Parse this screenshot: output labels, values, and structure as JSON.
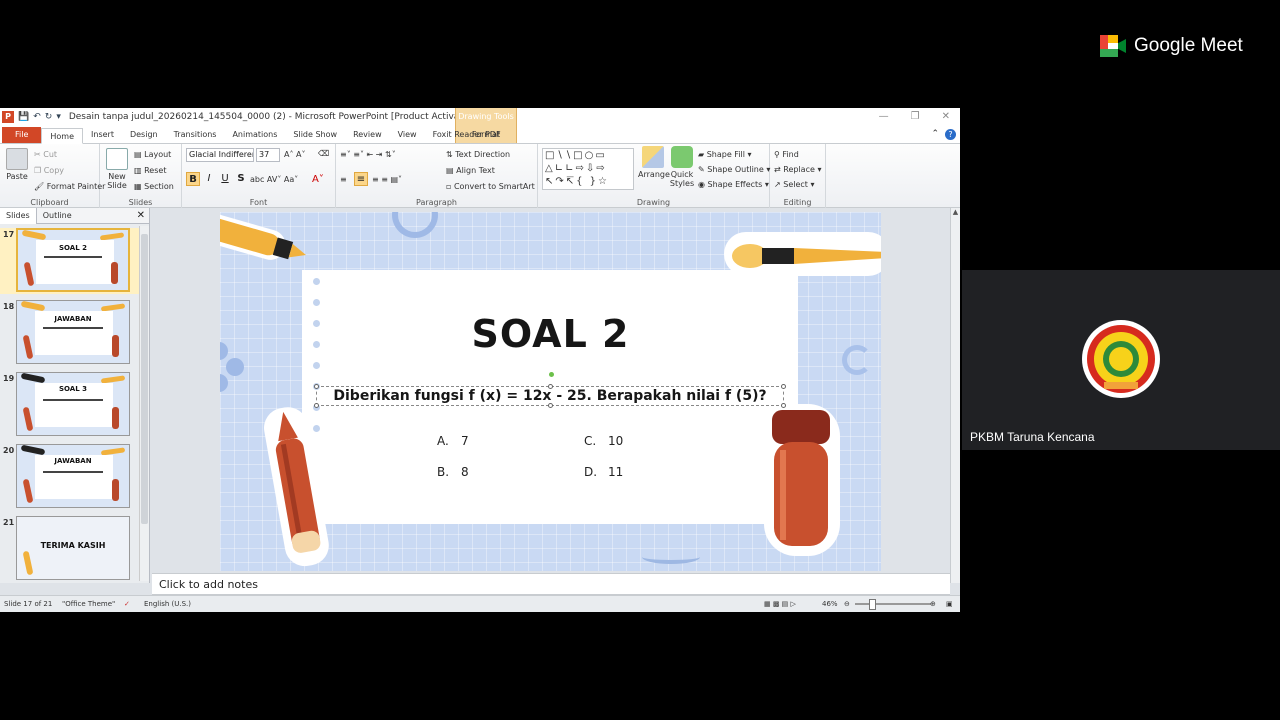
{
  "window": {
    "title": "Desain tanpa judul_20260214_145504_0000 (2)  -  Microsoft PowerPoint [Product Activatio...",
    "context_tab_title": "Drawing Tools"
  },
  "ribbon_tabs": [
    "File",
    "Home",
    "Insert",
    "Design",
    "Transitions",
    "Animations",
    "Slide Show",
    "Review",
    "View",
    "Foxit Reader PDF"
  ],
  "format_tab": "Format",
  "clipboard": {
    "paste": "Paste",
    "cut": "Cut",
    "copy": "Copy",
    "format_painter": "Format Painter",
    "label": "Clipboard"
  },
  "slides_group": {
    "new_slide": "New Slide",
    "layout": "Layout",
    "reset": "Reset",
    "section": "Section",
    "label": "Slides"
  },
  "font_group": {
    "font_name": "Glacial Indifferenc",
    "font_size": "37",
    "label": "Font",
    "bold": "B",
    "italic": "I",
    "underline": "U",
    "strike": "S"
  },
  "paragraph_group": {
    "text_direction": "Text Direction",
    "align_text": "Align Text",
    "smartart": "Convert to SmartArt",
    "label": "Paragraph"
  },
  "drawing_group": {
    "arrange": "Arrange",
    "quick_styles": "Quick Styles",
    "shape_fill": "Shape Fill",
    "shape_outline": "Shape Outline",
    "shape_effects": "Shape Effects",
    "label": "Drawing"
  },
  "editing_group": {
    "find": "Find",
    "replace": "Replace",
    "select": "Select",
    "label": "Editing"
  },
  "panel": {
    "tab_slides": "Slides",
    "tab_outline": "Outline"
  },
  "thumbnails": [
    {
      "num": "17",
      "title": "SOAL 2"
    },
    {
      "num": "18",
      "title": "JAWABAN"
    },
    {
      "num": "19",
      "title": "SOAL 3"
    },
    {
      "num": "20",
      "title": "JAWABAN"
    },
    {
      "num": "21",
      "title": "TERIMA KASIH"
    }
  ],
  "slide": {
    "title": "SOAL 2",
    "question": "Diberikan fungsi f (x) = 12x - 25. Berapakah nilai f (5)?",
    "options": [
      {
        "letter": "A.",
        "value": "7"
      },
      {
        "letter": "B.",
        "value": "8"
      },
      {
        "letter": "C.",
        "value": "10"
      },
      {
        "letter": "D.",
        "value": "11"
      }
    ]
  },
  "notes_placeholder": "Click to add notes",
  "status": {
    "slide": "Slide 17 of 21",
    "theme": "\"Office Theme\"",
    "language": "English (U.S.)",
    "zoom": "46%"
  },
  "meet": {
    "brand": "Google Meet",
    "participant": "PKBM Taruna Kencana"
  }
}
